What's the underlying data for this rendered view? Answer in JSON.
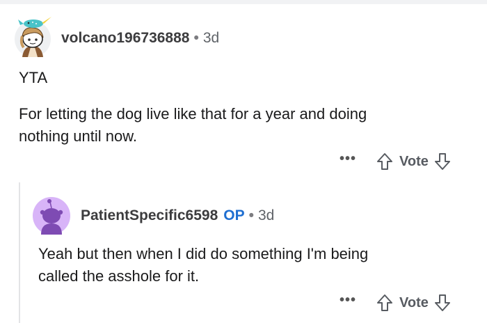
{
  "comment": {
    "username": "volcano196736888",
    "separator": "•",
    "age": "3d",
    "body": [
      "YTA",
      "For letting the dog live like that for a year and doing",
      "nothing until now."
    ],
    "more_label": "•••",
    "vote_label": "Vote",
    "avatar_icon": "snoo-avatar-with-narwhal-hat-icon"
  },
  "reply": {
    "username": "PatientSpecific6598",
    "op_badge": "OP",
    "separator": "•",
    "age": "3d",
    "body": [
      "Yeah but then when I did do something I'm being",
      "called the asshole for it."
    ],
    "more_label": "•••",
    "vote_label": "Vote",
    "avatar_icon": "default-snoo-avatar-icon"
  },
  "colors": {
    "username": "#3c3c3e",
    "op_badge": "#1f6fd1",
    "reply_avatar_bg": "#d8b4f8",
    "reply_avatar_figure": "#7e4bb3",
    "thread_line": "#e3e4e6"
  }
}
